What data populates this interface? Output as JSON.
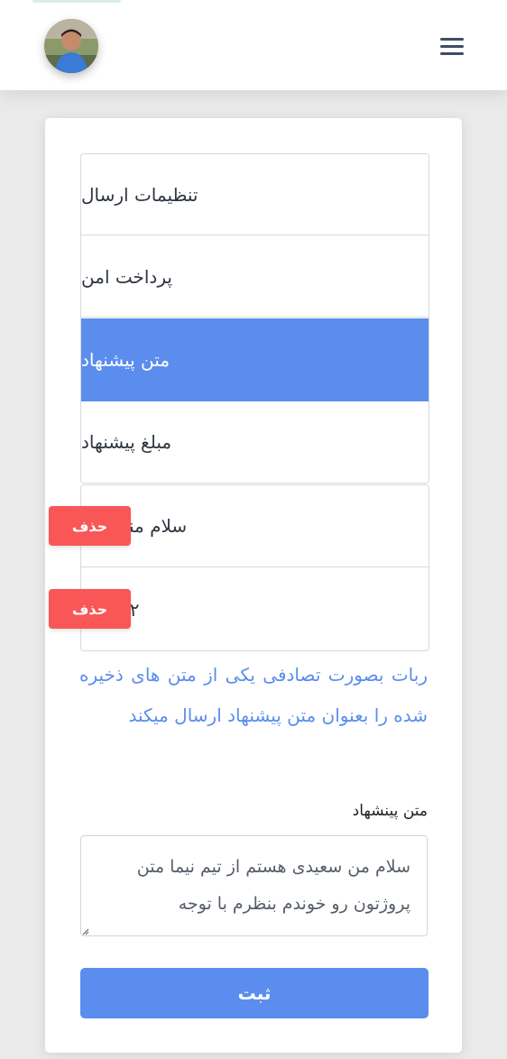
{
  "header": {
    "avatar_icon": "user-avatar-photo",
    "menu_icon": "hamburger-menu-icon"
  },
  "tabs": [
    {
      "label": "تنظیمات ارسال",
      "active": false
    },
    {
      "label": "پرداخت امن",
      "active": false
    },
    {
      "label": "متن پیشنهاد",
      "active": true
    },
    {
      "label": "مبلغ پیشنهاد",
      "active": false
    }
  ],
  "saved_texts": [
    {
      "text": "سلام منم هاااا",
      "delete_label": "حذف"
    },
    {
      "text": "۲۲۲۲۲۲",
      "delete_label": "حذف"
    }
  ],
  "info_text": "ربات بصورت تصادفی یکی از متن های ذخیره شده را بعنوان متن پیشنهاد ارسال میکند",
  "form": {
    "label": "متن پینشهاد",
    "textarea_value": "سلام من سعیدی هستم از تیم نیما متن پروژتون رو خوندم بنظرم با توجه",
    "submit_label": "ثبت"
  },
  "colors": {
    "accent": "#5b8def",
    "danger": "#f95757"
  }
}
